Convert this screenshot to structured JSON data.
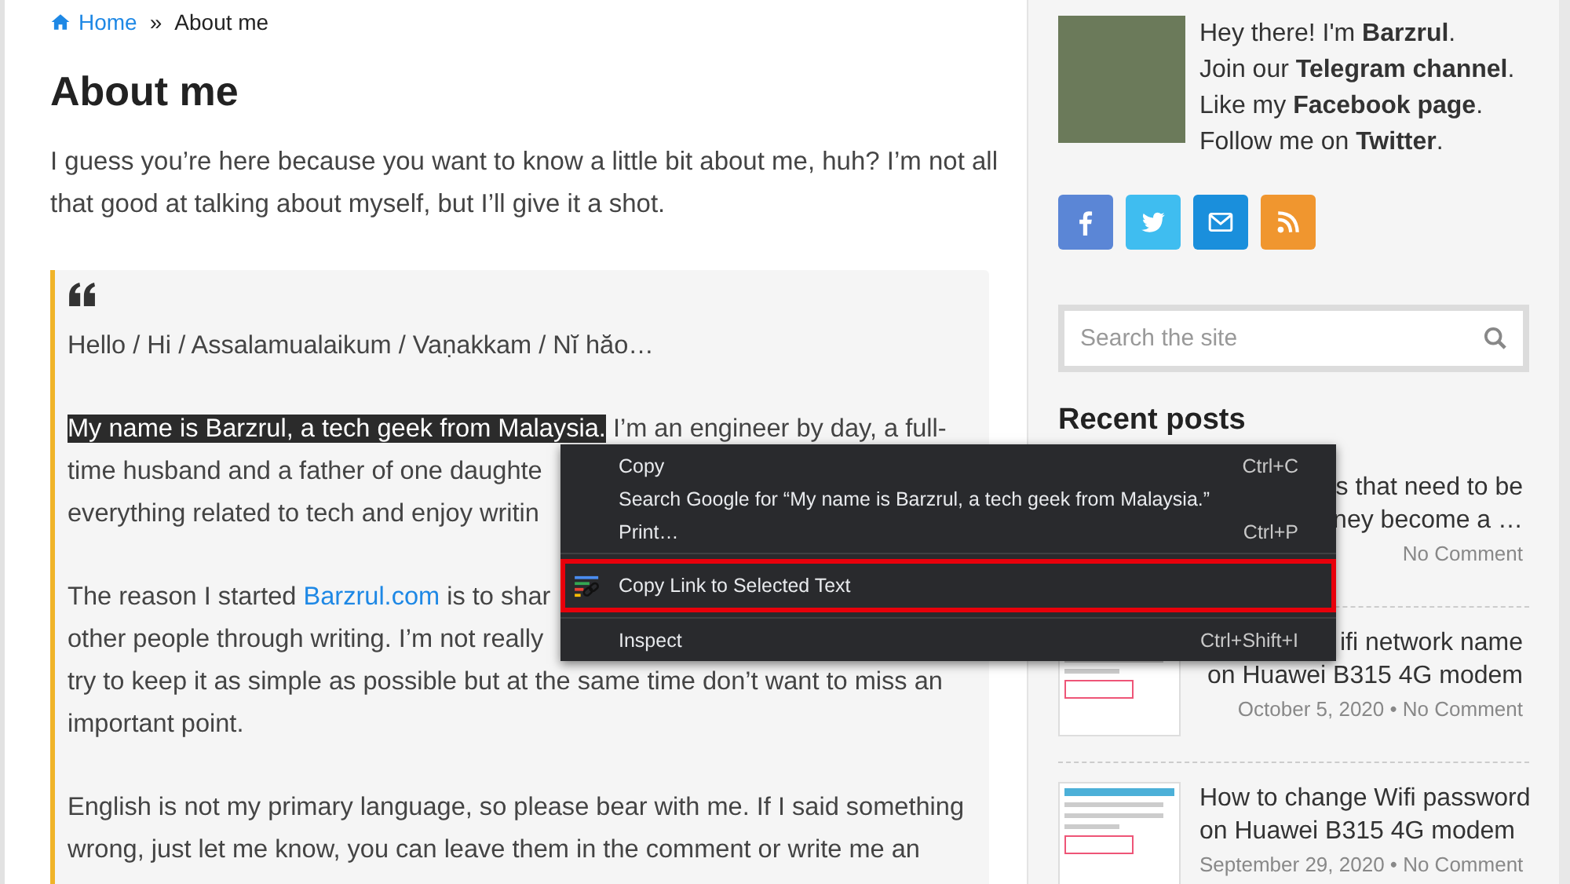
{
  "breadcrumb": {
    "home": "Home",
    "separator": "»",
    "current": "About me"
  },
  "title": "About me",
  "intro": "I guess you’re here because you want to know a little bit about me, huh? I’m not all that good at talking about myself, but I’ll give it a shot.",
  "quote": {
    "paragraphs": [
      [
        [
          {
            "text": "Hello / Hi / Assalamualaikum / Vaṇakkam / Nĭ hăo…",
            "kind": "plain"
          }
        ]
      ],
      [
        [
          {
            "text": "My name is Barzrul, a tech geek from Malaysia.",
            "kind": "selected"
          },
          {
            "text": " I’m an engineer by day, a full-",
            "kind": "plain"
          }
        ],
        [
          {
            "text": "time husband and a father of one daughte",
            "kind": "plain"
          }
        ],
        [
          {
            "text": "everything related to tech and enjoy writin",
            "kind": "plain"
          }
        ]
      ],
      [
        [
          {
            "text": "The reason I started ",
            "kind": "plain"
          },
          {
            "text": "Barzrul.com",
            "kind": "link"
          },
          {
            "text": " is to shar",
            "kind": "plain"
          }
        ],
        [
          {
            "text": "other people through writing. I’m not really",
            "kind": "plain"
          }
        ],
        [
          {
            "text": "try to keep it as simple as possible but at the same time don’t want to miss an",
            "kind": "plain"
          }
        ],
        [
          {
            "text": "important point.",
            "kind": "plain"
          }
        ]
      ],
      [
        [
          {
            "text": "English is not my primary language, so please bear with me. If I said something",
            "kind": "plain"
          }
        ],
        [
          {
            "text": "wrong, just let me know, you can leave them in the comment or write me an",
            "kind": "plain"
          }
        ]
      ]
    ]
  },
  "bio": [
    "Hey there! I'm **Barzrul**.",
    "Join our **Telegram channel**.",
    "Like my **Facebook page**.",
    "Follow me on **Twitter**."
  ],
  "social": [
    {
      "kind": "facebook",
      "color": "#5b86d6"
    },
    {
      "kind": "twitter",
      "color": "#3fbdf0"
    },
    {
      "kind": "email",
      "color": "#1a8fdc"
    },
    {
      "kind": "rss",
      "color": "#f0962f"
    }
  ],
  "search": {
    "placeholder": "Search the site"
  },
  "recent_posts": {
    "heading": "Recent posts",
    "posts": [
      {
        "title_lines": [
          "s that need to be",
          "ney become a …"
        ],
        "meta": "No Comment",
        "clipped": true
      },
      {
        "title_lines": [
          "ifi network name",
          "on Huawei B315 4G modem"
        ],
        "meta": "October 5, 2020 • No Comment",
        "clipped": true
      },
      {
        "title_lines": [
          "How to change Wifi password",
          "on Huawei B315 4G modem"
        ],
        "meta": "September 29, 2020 • No Comment",
        "clipped": false
      }
    ]
  },
  "context_menu": {
    "items": [
      {
        "label": "Copy",
        "shortcut": "Ctrl+C",
        "kind": "item",
        "selected": false
      },
      {
        "label": "Search Google for “My name is Barzrul, a tech geek from Malaysia.”",
        "kind": "item",
        "selected": false
      },
      {
        "label": "Print…",
        "shortcut": "Ctrl+P",
        "kind": "item",
        "selected": false
      },
      {
        "kind": "separator"
      },
      {
        "label": "Copy Link to Selected Text",
        "kind": "link-item",
        "selected": true
      },
      {
        "kind": "separator"
      },
      {
        "label": "Inspect",
        "shortcut": "Ctrl+Shift+I",
        "kind": "item",
        "selected": false
      }
    ]
  }
}
